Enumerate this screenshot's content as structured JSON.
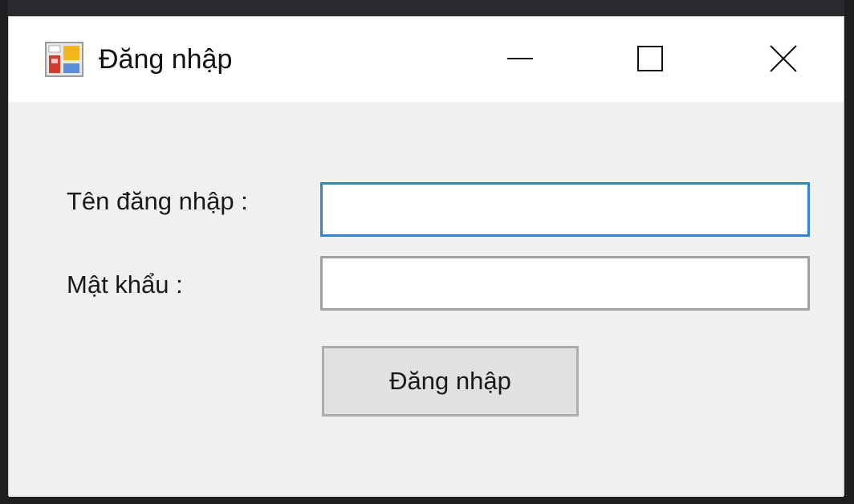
{
  "window": {
    "title": "Đăng nhập",
    "icon": "form-app-icon",
    "controls": {
      "minimize_icon": "minimize-icon",
      "maximize_icon": "maximize-icon",
      "close_icon": "close-icon"
    }
  },
  "form": {
    "username_label": "Tên đăng nhập :",
    "username_value": "",
    "password_label": "Mật khẩu :",
    "password_value": "",
    "login_button_label": "Đăng nhập"
  },
  "colors": {
    "focus_border": "#2f84d8",
    "window_background": "#f0f0f0",
    "titlebar_background": "#ffffff",
    "button_background": "#e1e1e1"
  }
}
